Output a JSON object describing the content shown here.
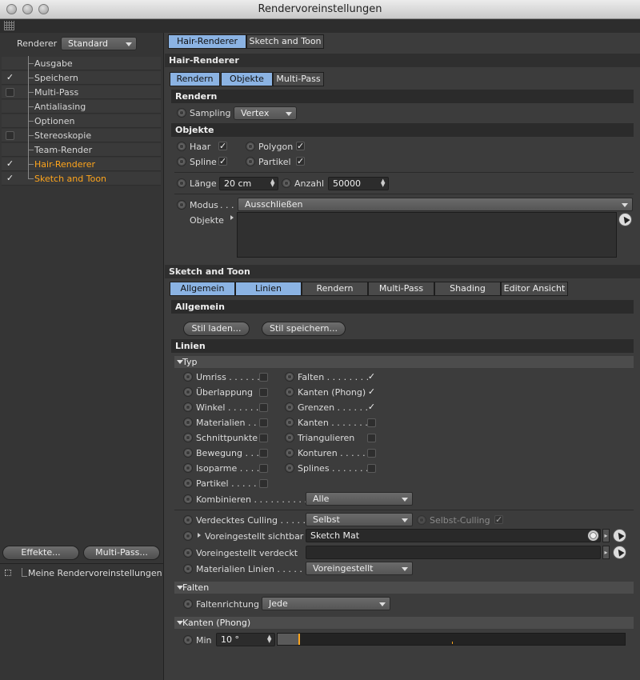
{
  "window": {
    "title": "Rendervoreinstellungen"
  },
  "left": {
    "renderer_label": "Renderer",
    "renderer_value": "Standard",
    "items": [
      {
        "label": "Ausgabe",
        "check": ""
      },
      {
        "label": "Speichern",
        "check": "✓"
      },
      {
        "label": "Multi-Pass",
        "check": ""
      },
      {
        "label": "Antialiasing",
        "check": ""
      },
      {
        "label": "Optionen",
        "check": ""
      },
      {
        "label": "Stereoskopie",
        "check": ""
      },
      {
        "label": "Team-Render",
        "check": ""
      },
      {
        "label": "Hair-Renderer",
        "check": "✓"
      },
      {
        "label": "Sketch and Toon",
        "check": "✓"
      }
    ],
    "effects_button": "Effekte...",
    "multipass_button": "Multi-Pass...",
    "preset_label": "Meine Rendervoreinstellungen"
  },
  "top_tabs": [
    "Hair-Renderer",
    "Sketch and Toon"
  ],
  "hair": {
    "header": "Hair-Renderer",
    "tabs": [
      "Rendern",
      "Objekte",
      "Multi-Pass"
    ],
    "rendern_header": "Rendern",
    "sampling_label": "Sampling",
    "sampling_value": "Vertex",
    "objekte_header": "Objekte",
    "haar": "Haar",
    "polygon": "Polygon",
    "spline": "Spline",
    "partikel": "Partikel",
    "check": "✓",
    "laenge_label": "Länge",
    "laenge_value": "20 cm",
    "anzahl_label": "Anzahl",
    "anzahl_value": "50000",
    "modus_label": "Modus",
    "modus_dots": ". . .",
    "modus_value": "Ausschließen",
    "objekte_label": "Objekte"
  },
  "sketch": {
    "header": "Sketch and Toon",
    "tabs": [
      "Allgemein",
      "Linien",
      "Rendern",
      "Multi-Pass",
      "Shading",
      "Editor Ansicht"
    ],
    "allgemein_header": "Allgemein",
    "stil_laden": "Stil laden...",
    "stil_speichern": "Stil speichern...",
    "linien_header": "Linien",
    "typ_header": "Typ",
    "left_col": [
      {
        "label": "Umriss . . . . . .",
        "check": ""
      },
      {
        "label": "Überlappung",
        "check": ""
      },
      {
        "label": "Winkel . . . . . .",
        "check": ""
      },
      {
        "label": "Materialien . .",
        "check": ""
      },
      {
        "label": "Schnittpunkte",
        "check": ""
      },
      {
        "label": "Bewegung . . .",
        "check": ""
      },
      {
        "label": "Isoparme . . . .",
        "check": ""
      },
      {
        "label": "Partikel . . . . .",
        "check": ""
      }
    ],
    "right_col": [
      {
        "label": "Falten . . . . . . . .",
        "check": "✓"
      },
      {
        "label": "Kanten (Phong)",
        "check": "✓"
      },
      {
        "label": "Grenzen . . . . . .",
        "check": "✓"
      },
      {
        "label": "Kanten . . . . . . .",
        "check": ""
      },
      {
        "label": "Triangulieren",
        "check": ""
      },
      {
        "label": "Konturen . . . . .",
        "check": ""
      },
      {
        "label": "Splines . . . . . . .",
        "check": ""
      }
    ],
    "kombinieren_label": "Kombinieren . . . . . . . . . . .",
    "kombinieren_value": "Alle",
    "culling_label": "Verdecktes Culling . . . . .",
    "culling_value": "Selbst",
    "selbst_culling_label": "Selbst-Culling",
    "selbst_culling_check": "✓",
    "sichtbar_label": "Voreingestellt sichtbar",
    "sichtbar_value": "Sketch Mat",
    "verdeckt_label": "Voreingestellt verdeckt",
    "verdeckt_value": "",
    "mat_linien_label": "Materialien Linien . . . . .",
    "mat_linien_value": "Voreingestellt",
    "falten_header": "Falten",
    "faltenrichtung_label": "Faltenrichtung",
    "faltenrichtung_value": "Jede",
    "kanten_header": "Kanten (Phong)",
    "min_label": "Min",
    "min_value": "10 °",
    "min_fraction": 0.06
  }
}
